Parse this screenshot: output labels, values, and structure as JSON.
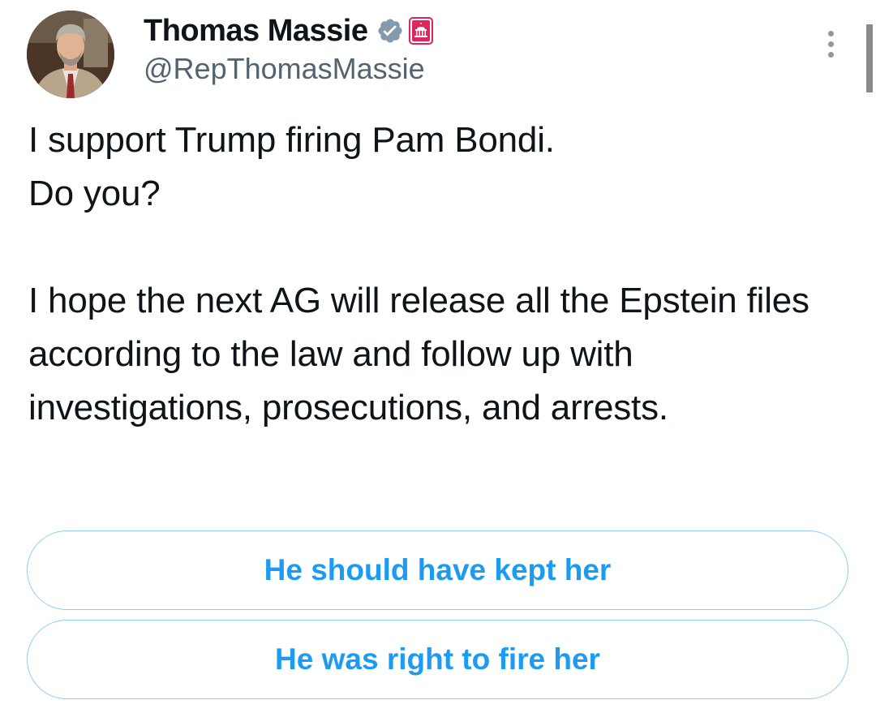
{
  "author": {
    "display_name": "Thomas Massie",
    "handle": "@RepThomasMassie",
    "verified_badge_icon": "verified-badge-icon",
    "affiliation_badge_icon": "capitol-affiliation-icon",
    "verified_color": "#829aab",
    "affiliation_color": "#e0245e"
  },
  "tweet": {
    "text": "I support Trump firing Pam Bondi.\nDo you?\n\nI hope the next AG will release all the Epstein files according to the law and follow up with investigations, prosecutions, and arrests."
  },
  "poll": {
    "options": [
      {
        "label": "He should have kept her"
      },
      {
        "label": "He was right to fire her"
      }
    ],
    "accent_color": "#1d9bf0"
  },
  "menu": {
    "icon": "more-options-icon"
  }
}
